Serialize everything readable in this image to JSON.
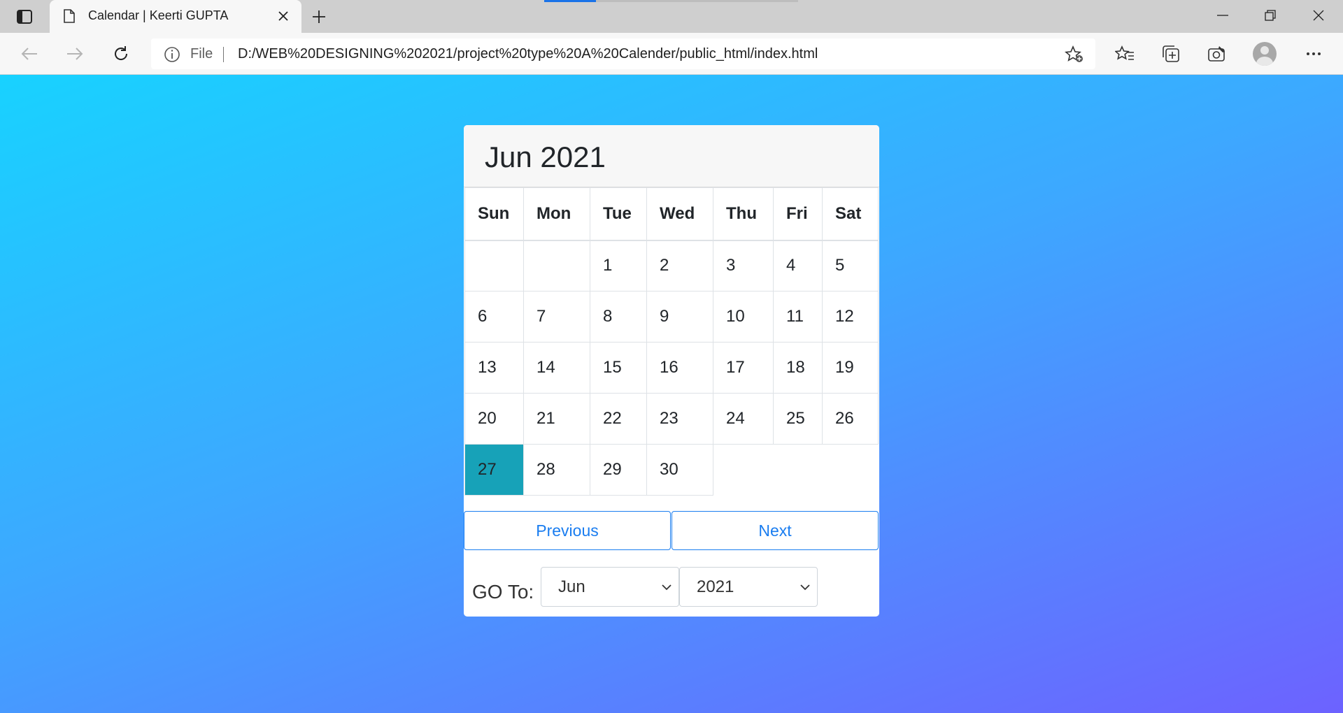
{
  "browser": {
    "tab_title": "Calendar | Keerti GUPTA",
    "address_scheme": "File",
    "address_url": "D:/WEB%20DESIGNING%202021/project%20type%20A%20Calender/public_html/index.html"
  },
  "calendar": {
    "title": "Jun 2021",
    "weekdays": [
      "Sun",
      "Mon",
      "Tue",
      "Wed",
      "Thu",
      "Fri",
      "Sat"
    ],
    "weeks": [
      [
        "",
        "",
        "1",
        "2",
        "3",
        "4",
        "5"
      ],
      [
        "6",
        "7",
        "8",
        "9",
        "10",
        "11",
        "12"
      ],
      [
        "13",
        "14",
        "15",
        "16",
        "17",
        "18",
        "19"
      ],
      [
        "20",
        "21",
        "22",
        "23",
        "24",
        "25",
        "26"
      ],
      [
        "27",
        "28",
        "29",
        "30"
      ]
    ],
    "today": "27",
    "today_color": "#17a2b8",
    "previous_label": "Previous",
    "next_label": "Next",
    "goto_label": "GO To:",
    "month_select": "Jun",
    "year_select": "2021"
  },
  "colors": {
    "accent": "#1a7df0",
    "background_gradient": [
      "#18d2ff",
      "#6d62ff"
    ]
  }
}
